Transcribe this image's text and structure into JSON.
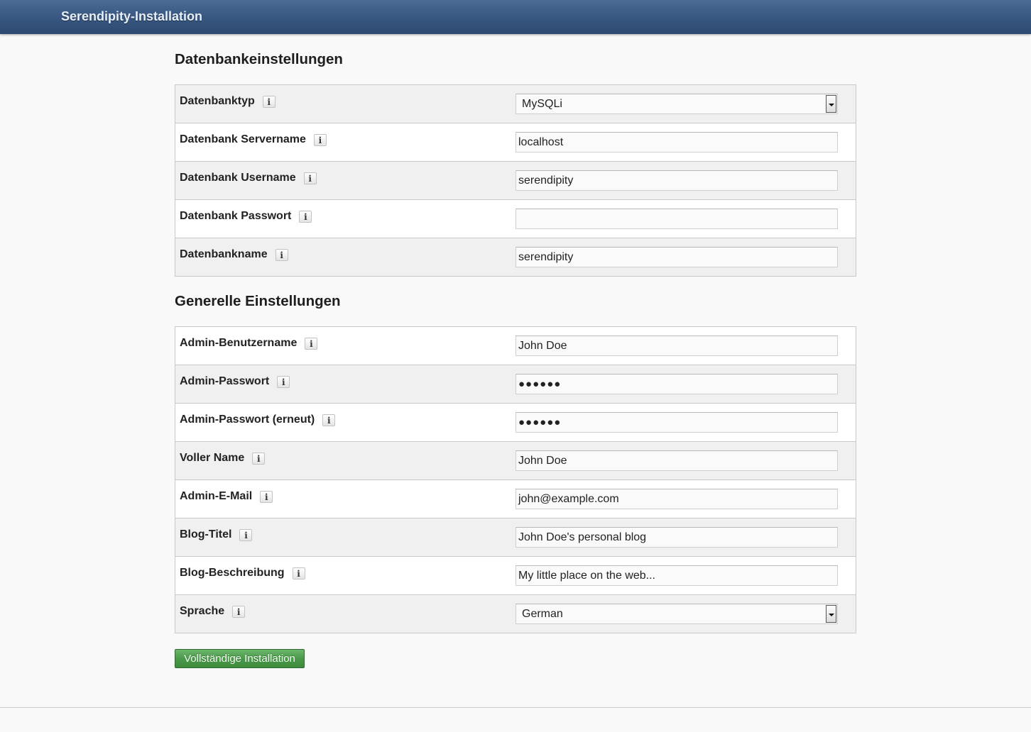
{
  "header": {
    "title": "Serendipity-Installation"
  },
  "database_section": {
    "heading": "Datenbankeinstellungen",
    "fields": [
      {
        "label": "Datenbanktyp",
        "info": "i",
        "value": "MySQLi",
        "type": "select"
      },
      {
        "label": "Datenbank Servername",
        "info": "i",
        "value": "localhost",
        "type": "text"
      },
      {
        "label": "Datenbank Username",
        "info": "i",
        "value": "serendipity",
        "type": "text"
      },
      {
        "label": "Datenbank Passwort",
        "info": "i",
        "value": "",
        "type": "password"
      },
      {
        "label": "Datenbankname",
        "info": "i",
        "value": "serendipity",
        "type": "text"
      }
    ]
  },
  "general_section": {
    "heading": "Generelle Einstellungen",
    "fields": [
      {
        "label": "Admin-Benutzername",
        "info": "i",
        "value": "John Doe",
        "type": "text"
      },
      {
        "label": "Admin-Passwort",
        "info": "i",
        "value": "●●●●●●",
        "type": "password"
      },
      {
        "label": "Admin-Passwort (erneut)",
        "info": "i",
        "value": "●●●●●●",
        "type": "password"
      },
      {
        "label": "Voller Name",
        "info": "i",
        "value": "John Doe",
        "type": "text"
      },
      {
        "label": "Admin-E-Mail",
        "info": "i",
        "value": "john@example.com",
        "type": "text"
      },
      {
        "label": "Blog-Titel",
        "info": "i",
        "value": "John Doe's personal blog",
        "type": "text"
      },
      {
        "label": "Blog-Beschreibung",
        "info": "i",
        "value": "My little place on the web...",
        "type": "text"
      },
      {
        "label": "Sprache",
        "info": "i",
        "value": "German",
        "type": "select"
      }
    ]
  },
  "submit": {
    "label": "Vollständige Installation"
  },
  "colors": {
    "header_bg": "#375680",
    "header_text": "#e8eef6",
    "submit_bg": "#4a9a4a",
    "row_alt_bg": "#f0f0f0",
    "border": "#c8c8c8"
  }
}
